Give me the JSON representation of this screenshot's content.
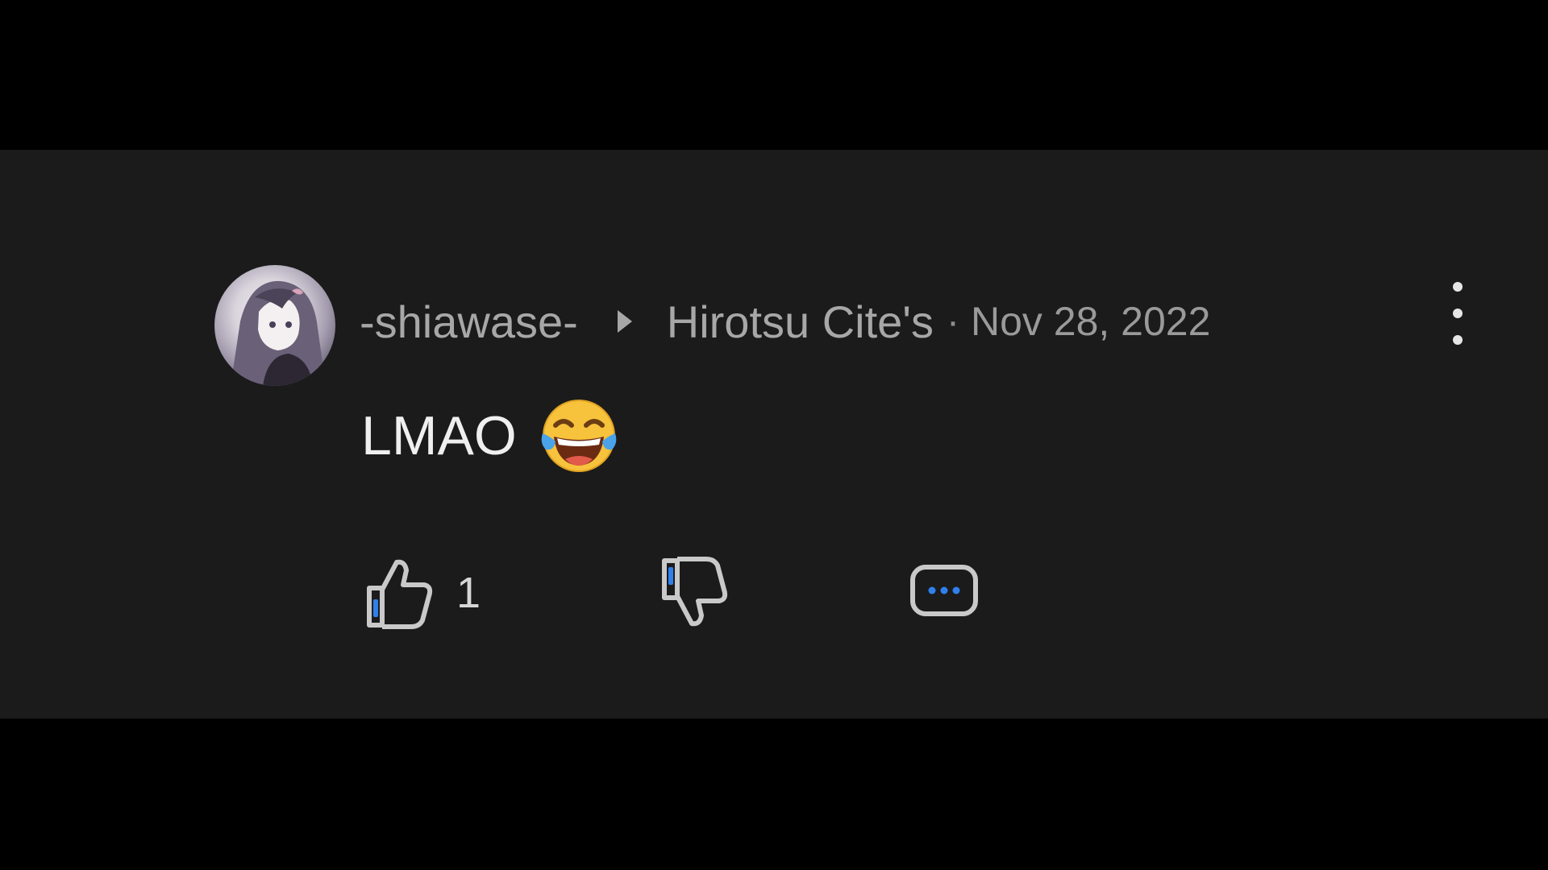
{
  "comment": {
    "author": "-shiawase-",
    "reply_to": "Hirotsu Cite's",
    "separator": "·",
    "timestamp": "Nov 28, 2022",
    "text": "LMAO",
    "emoji": "face-with-tears-of-joy-icon",
    "like_count": "1"
  },
  "icons": {
    "reply_arrow": "play-arrow-icon",
    "more": "more-vertical-icon",
    "like": "thumbs-up-icon",
    "dislike": "thumbs-down-icon",
    "reply": "comment-bubble-icon"
  },
  "colors": {
    "background": "#1b1b1b",
    "letterbox": "#000000",
    "text_primary": "#efefef",
    "text_secondary": "#a7a7a7",
    "accent": "#2f80ed"
  }
}
